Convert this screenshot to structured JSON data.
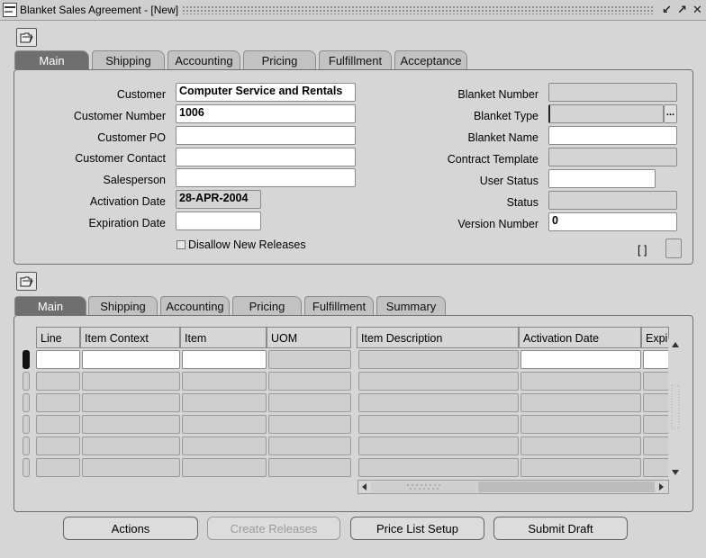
{
  "window": {
    "title": "Blanket Sales Agreement - [New]",
    "minimize_glyph": "↙",
    "maximize_glyph": "↗",
    "close_glyph": "✕"
  },
  "header_tabs": [
    "Main",
    "Shipping",
    "Accounting",
    "Pricing",
    "Fulfillment",
    "Acceptance"
  ],
  "header": {
    "customer_label": "Customer",
    "customer_value": "Computer Service and Rentals",
    "customer_number_label": "Customer Number",
    "customer_number_value": "1006",
    "customer_po_label": "Customer PO",
    "customer_po_value": "",
    "customer_contact_label": "Customer Contact",
    "customer_contact_value": "",
    "salesperson_label": "Salesperson",
    "salesperson_value": "",
    "activation_date_label": "Activation Date",
    "activation_date_value": "28-APR-2004",
    "expiration_date_label": "Expiration Date",
    "expiration_date_value": "",
    "disallow_label": "Disallow New Releases",
    "disallow_checked": false,
    "blanket_number_label": "Blanket Number",
    "blanket_number_value": "",
    "blanket_type_label": "Blanket Type",
    "blanket_type_value": "",
    "blanket_name_label": "Blanket Name",
    "blanket_name_value": "",
    "contract_template_label": "Contract Template",
    "contract_template_value": "",
    "user_status_label": "User Status",
    "user_status_value": "",
    "status_label": "Status",
    "status_value": "",
    "version_number_label": "Version Number",
    "version_number_value": "0",
    "flex_field_text": "[ ]",
    "lov_button_text": "..."
  },
  "line_tabs": [
    "Main",
    "Shipping",
    "Accounting",
    "Pricing",
    "Fulfillment",
    "Summary"
  ],
  "lines": {
    "columns": [
      "Line",
      "Item Context",
      "Item",
      "UOM",
      "Item Description",
      "Activation Date",
      "Expi"
    ],
    "row_count": 6
  },
  "buttons": {
    "actions": "Actions",
    "create_releases": "Create Releases",
    "price_list_setup": "Price List Setup",
    "submit_draft": "Submit Draft"
  },
  "colors": {
    "background": "#d6d6d6",
    "active_tab": "#6f6f6f",
    "field_white": "#ffffff",
    "field_readonly": "#d4d4d4"
  }
}
